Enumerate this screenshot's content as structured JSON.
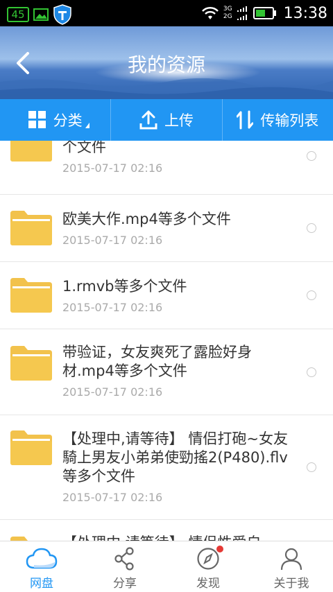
{
  "status_bar": {
    "battery_level": "45",
    "signal_labels": [
      "3G",
      "2G"
    ],
    "time": "13:38"
  },
  "header": {
    "title": "我的资源"
  },
  "toolbar": {
    "category_label": "分类",
    "upload_label": "上传",
    "transfer_label": "传输列表",
    "accent_color": "#2196f3"
  },
  "files": [
    {
      "name": "个文件",
      "date": "2015-07-17  02:16"
    },
    {
      "name": "欧美大作.mp4等多个文件",
      "date": "2015-07-17  02:16"
    },
    {
      "name": "1.rmvb等多个文件",
      "date": "2015-07-17  02:16"
    },
    {
      "name": "带验证，女友爽死了露脸好身材.mp4等多个文件",
      "date": "2015-07-17  02:16"
    },
    {
      "name": "【处理中,请等待】 情侣打砲~女友騎上男友小弟弟使勁搖2(P480).flv等多个文件",
      "date": "2015-07-17  02:16"
    },
    {
      "name": "【处理中,请等待】 情侣性爱自",
      "date": ""
    }
  ],
  "bottom_nav": {
    "items": [
      {
        "label": "网盘",
        "icon": "cloud-icon",
        "active": true
      },
      {
        "label": "分享",
        "icon": "share-icon",
        "active": false
      },
      {
        "label": "发现",
        "icon": "compass-icon",
        "active": false
      },
      {
        "label": "关于我",
        "icon": "person-icon",
        "active": false
      }
    ]
  }
}
